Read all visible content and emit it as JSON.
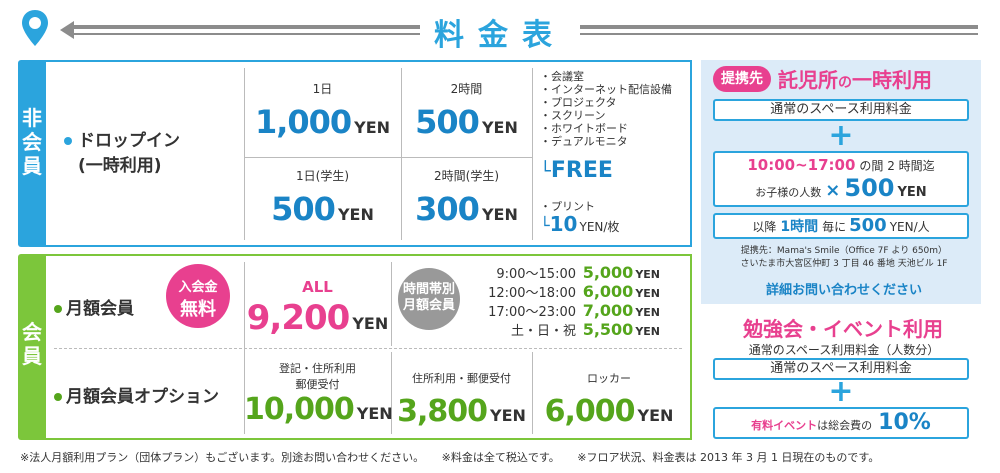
{
  "header": {
    "title": "料金表"
  },
  "colors": {
    "blue": "#2ba4dd",
    "green": "#7cc63b",
    "pink": "#e8408f",
    "gray": "#8c8c8c"
  },
  "icons": {
    "pin": "map-pin-icon"
  },
  "nonmember": {
    "label": "非会員",
    "plan_line1": "ドロップイン",
    "plan_line2": "(一時利用)",
    "day": {
      "label": "1日",
      "price": "1,000",
      "unit": "YEN"
    },
    "two_hours": {
      "label": "2時間",
      "price": "500",
      "unit": "YEN"
    },
    "day_student": {
      "label": "1日(学生)",
      "price": "500",
      "unit": "YEN"
    },
    "two_hours_student": {
      "label": "2時間(学生)",
      "price": "300",
      "unit": "YEN"
    },
    "equipment": [
      "・会議室",
      "・インターネット配信設備",
      "・プロジェクタ",
      "・スクリーン",
      "・ホワイトボード",
      "・デュアルモニタ"
    ],
    "free_label": "FREE",
    "print_label": "・プリント",
    "print_price": "10",
    "print_unit": "YEN/枚"
  },
  "member": {
    "label": "会員",
    "monthly_label": "月額会員",
    "entry_fee_line1": "入会金",
    "entry_fee_line2": "無料",
    "all_label": "ALL",
    "all_price": "9,200",
    "all_unit": "YEN",
    "timezone_line1": "時間帯別",
    "timezone_line2": "月額会員",
    "slots": [
      {
        "time": "9:00〜15:00",
        "price": "5,000",
        "unit": "YEN"
      },
      {
        "time": "12:00〜18:00",
        "price": "6,000",
        "unit": "YEN"
      },
      {
        "time": "17:00〜23:00",
        "price": "7,000",
        "unit": "YEN"
      },
      {
        "time": "土・日・祝",
        "price": "5,500",
        "unit": "YEN"
      }
    ],
    "option_label": "月額会員オプション",
    "options": [
      {
        "label_line1": "登記・住所利用",
        "label_line2": "郵便受付",
        "price": "10,000",
        "unit": "YEN"
      },
      {
        "label_line1": "住所利用・郵便受付",
        "label_line2": "",
        "price": "3,800",
        "unit": "YEN"
      },
      {
        "label_line1": "ロッカー",
        "label_line2": "",
        "price": "6,000",
        "unit": "YEN"
      }
    ]
  },
  "childcare": {
    "badge": "提携先",
    "title_a": "託児所",
    "title_b": "の",
    "title_c": "一時利用",
    "base_fee": "通常のスペース利用料金",
    "plus": "+",
    "time_range": "10:00~17:00",
    "time_suffix": "の間 2 時間迄",
    "children_label": "お子様の人数",
    "times": "×",
    "child_price": "500",
    "child_unit": "YEN",
    "after_prefix": "以降",
    "after_hour": "1時間",
    "after_mid": "毎に",
    "after_price": "500",
    "after_unit": "YEN/人",
    "partner_line1": "提携先：Mama's Smile（Office 7F より 650m）",
    "partner_line2": "さいたま市大宮区仲町 3 丁目 46 番地 天池ビル 1F",
    "inquiry": "詳細お問い合わせください"
  },
  "study": {
    "title": "勉強会・イベント利用",
    "subtitle": "通常のスペース利用料金（人数分）",
    "base_fee": "通常のスペース利用料金",
    "plus": "+",
    "event_prefix": "有料イベント",
    "event_mid": "は総会費の",
    "event_percent": "10%"
  },
  "footer": {
    "note1": "※法人月額利用プラン（団体プラン）もございます。別途お問い合わせください。",
    "note2": "※料金は全て税込です。",
    "note3": "※フロア状況、料金表は 2013 年 3 月 1 日現在のものです。"
  }
}
